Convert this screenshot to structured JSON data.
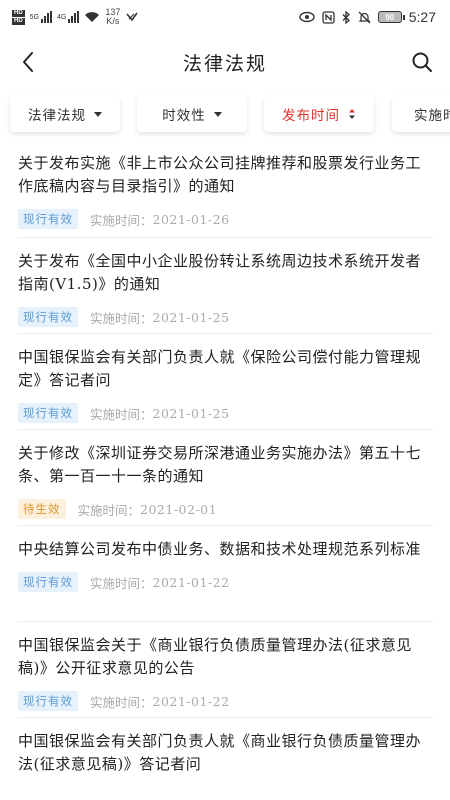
{
  "status_bar": {
    "hd1": "HD",
    "hd2": "HD",
    "net1": "5G",
    "net2": "4G",
    "speed_value": "137",
    "speed_unit": "K/s",
    "battery": "90",
    "time": "5:27"
  },
  "header": {
    "title": "法律法规",
    "back_icon": "chevron-left-icon",
    "search_icon": "search-icon"
  },
  "filters": [
    {
      "label": "法律法规",
      "active": false
    },
    {
      "label": "时效性",
      "active": false
    },
    {
      "label": "发布时间",
      "active": true
    },
    {
      "label": "实施时",
      "active": false
    }
  ],
  "date_prefix": "实施时间：",
  "items": [
    {
      "title": "关于发布实施《非上市公众公司挂牌推荐和股票发行业务工作底稿内容与目录指引》的通知",
      "status": "现行有效",
      "status_type": "valid",
      "date": "2021-01-26"
    },
    {
      "title": "关于发布《全国中小企业股份转让系统周边技术系统开发者指南(V1.5)》的通知",
      "status": "现行有效",
      "status_type": "valid",
      "date": "2021-01-25"
    },
    {
      "title": "中国银保监会有关部门负责人就《保险公司偿付能力管理规定》答记者问",
      "status": "现行有效",
      "status_type": "valid",
      "date": "2021-01-25"
    },
    {
      "title": "关于修改《深圳证券交易所深港通业务实施办法》第五十七条、第一百一十一条的通知",
      "status": "待生效",
      "status_type": "pending",
      "date": "2021-02-01"
    },
    {
      "title": "中央结算公司发布中债业务、数据和技术处理规范系列标准",
      "status": "现行有效",
      "status_type": "valid",
      "date": "2021-01-22"
    },
    {
      "title": "中国银保监会关于《商业银行负债质量管理办法(征求意见稿)》公开征求意见的公告",
      "status": "现行有效",
      "status_type": "valid",
      "date": "2021-01-22"
    },
    {
      "title": "中国银保监会有关部门负责人就《商业银行负债质量管理办法(征求意见稿)》答记者问",
      "status": "",
      "status_type": "valid",
      "date": ""
    }
  ]
}
